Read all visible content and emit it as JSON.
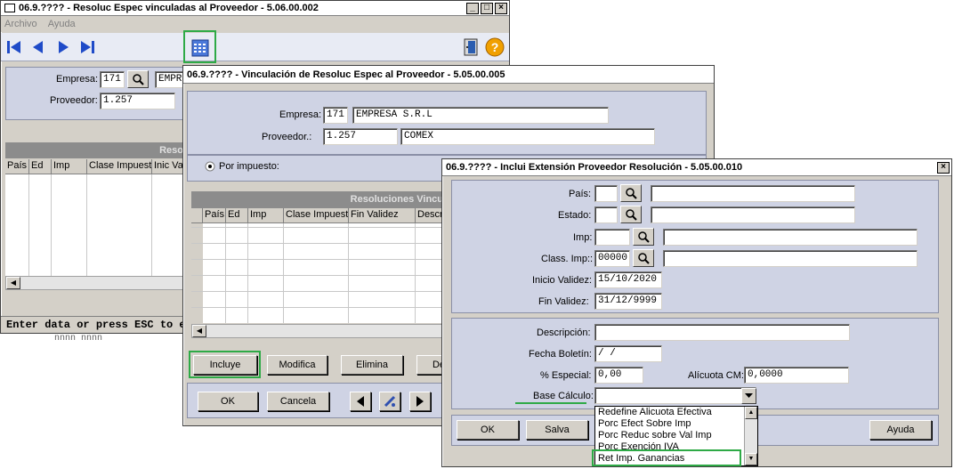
{
  "win1": {
    "title": "06.9.???? - Resoluc Espec vinculadas al Proveedor - 5.06.00.002",
    "menu": [
      "Archivo",
      "Ayuda"
    ],
    "empresa_label": "Empresa:",
    "empresa_code": "171",
    "empresa_name": "EMPRE",
    "proveedor_label": "Proveedor:",
    "proveedor_code": "1.257",
    "grid_title": "Reso",
    "columns": [
      "País",
      "Ed",
      "Imp",
      "Clase Impuest",
      "Inic Va"
    ],
    "status": "Enter data or press ESC to end",
    "status_tail": "nnnn nnnn"
  },
  "win2": {
    "title": "06.9.???? - Vinculación de Resoluc Espec al Proveedor - 5.05.00.005",
    "empresa_label": "Empresa:",
    "empresa_code": "171",
    "empresa_name": "EMPRESA  S.R.L",
    "proveedor_label": "Proveedor.:",
    "proveedor_code": "1.257",
    "proveedor_name": "COMEX",
    "radio_label": "Por impuesto:",
    "grid_title": "Resoluciones Vincu",
    "columns": [
      "País",
      "Ed",
      "Imp",
      "Clase Impuest",
      "Fin Validez",
      "Descr"
    ],
    "btn_incluye": "Incluye",
    "btn_modifica": "Modifica",
    "btn_elimina": "Elimina",
    "btn_de": "De",
    "btn_ok": "OK",
    "btn_cancela": "Cancela"
  },
  "win3": {
    "title": "06.9.???? - Inclui Extensión Proveedor Resolución - 5.05.00.010",
    "pais_label": "País:",
    "estado_label": "Estado:",
    "imp_label": "Imp:",
    "class_label": "Class. Imp::",
    "class_value": "00000",
    "inicio_label": "Inicio Validez:",
    "inicio_value": "15/10/2020",
    "fin_label": "Fin Validez:",
    "fin_value": "31/12/9999",
    "descripcion_label": "Descripción:",
    "fecha_label": "Fecha Boletín:",
    "fecha_value": " / /",
    "porc_label": "%  Especial:",
    "porc_value": "0,00",
    "alicuota_label": "Alícuota CM:",
    "alicuota_value": "0,0000",
    "base_label": "Base Cálculo:",
    "base_options": [
      "Redefine Alicuota Efectiva",
      "Porc Efect Sobre Imp",
      "Porc Reduc sobre Val Imp",
      "Porc Exención IVA",
      "Ret Imp. Ganancias"
    ],
    "btn_ok": "OK",
    "btn_salva": "Salva",
    "btn_ayuda": "Ayuda"
  },
  "colors": {
    "highlight": "#2eaa46",
    "panel": "#cfd3e4",
    "window": "#d4d0c8"
  }
}
